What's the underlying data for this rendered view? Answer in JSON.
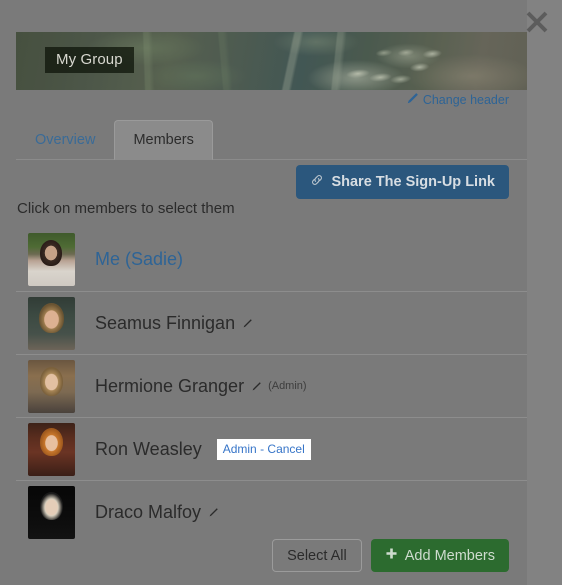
{
  "close_button": {
    "icon": "close-icon",
    "label": "Close"
  },
  "banner": {
    "group_title": "My Group",
    "change_header_label": "Change header",
    "change_header_icon": "pencil-icon"
  },
  "tabs": [
    {
      "label": "Overview",
      "active": false
    },
    {
      "label": "Members",
      "active": true
    }
  ],
  "share_button": {
    "label": "Share The Sign-Up Link",
    "icon": "link-icon",
    "color": "#2b577d"
  },
  "instruction": "Click on members to select them",
  "members": [
    {
      "name": "Me (Sadie)",
      "is_link": true,
      "edit_icon": "",
      "admin_tag": "",
      "admin_action": ""
    },
    {
      "name": "Seamus Finnigan",
      "is_link": false,
      "edit_icon": "pencil-icon",
      "admin_tag": "",
      "admin_action": ""
    },
    {
      "name": "Hermione Granger",
      "is_link": false,
      "edit_icon": "pencil-icon",
      "admin_tag": "(Admin)",
      "admin_action": ""
    },
    {
      "name": "Ron Weasley",
      "is_link": false,
      "edit_icon": "pencil-icon",
      "admin_tag": "",
      "admin_action": "Admin - Cancel"
    },
    {
      "name": "Draco Malfoy",
      "is_link": false,
      "edit_icon": "pencil-icon",
      "admin_tag": "",
      "admin_action": ""
    }
  ],
  "footer": {
    "select_all_label": "Select All",
    "add_members_label": "Add Members",
    "add_members_icon": "plus-icon",
    "add_members_color": "#2c6b2f"
  },
  "colors": {
    "overlay_background": "#828282",
    "modal_background": "#7a7a7a",
    "link_blue": "#2e6496",
    "text_dark": "#2b2b2b"
  }
}
